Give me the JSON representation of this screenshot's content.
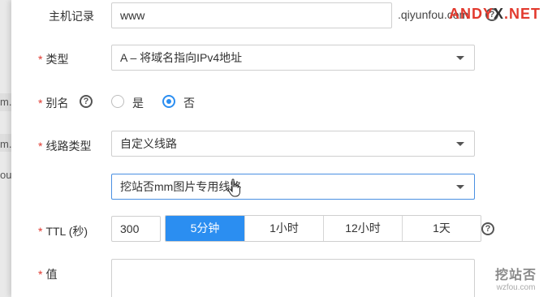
{
  "background_rows": [
    "m.",
    "m.",
    "ou."
  ],
  "form": {
    "host_record": {
      "label": "主机记录",
      "value": "www",
      "domain_suffix": ".qiyunfou.com"
    },
    "type": {
      "label": "类型",
      "value": "A – 将域名指向IPv4地址"
    },
    "alias": {
      "label": "别名",
      "options": [
        "是",
        "否"
      ],
      "selected": "否"
    },
    "line_type": {
      "label": "线路类型",
      "value": "自定义线路"
    },
    "custom_line": {
      "value": "挖站否mm图片专用线路"
    },
    "ttl": {
      "label": "TTL (秒)",
      "value": "300",
      "presets": [
        "5分钟",
        "1小时",
        "12小时",
        "1天"
      ],
      "selected": "5分钟"
    },
    "record_value": {
      "label": "值",
      "value": ""
    }
  },
  "required_mark": "*",
  "help_icon_glyph": "?",
  "watermark_top": {
    "part1": "ANDY",
    "part2": "X",
    "part3": ".NET"
  },
  "watermark_bottom": {
    "line1": "挖站否",
    "line2": "wzfou.com"
  },
  "colors": {
    "accent": "#2b8ef1",
    "required": "#e0382f"
  }
}
